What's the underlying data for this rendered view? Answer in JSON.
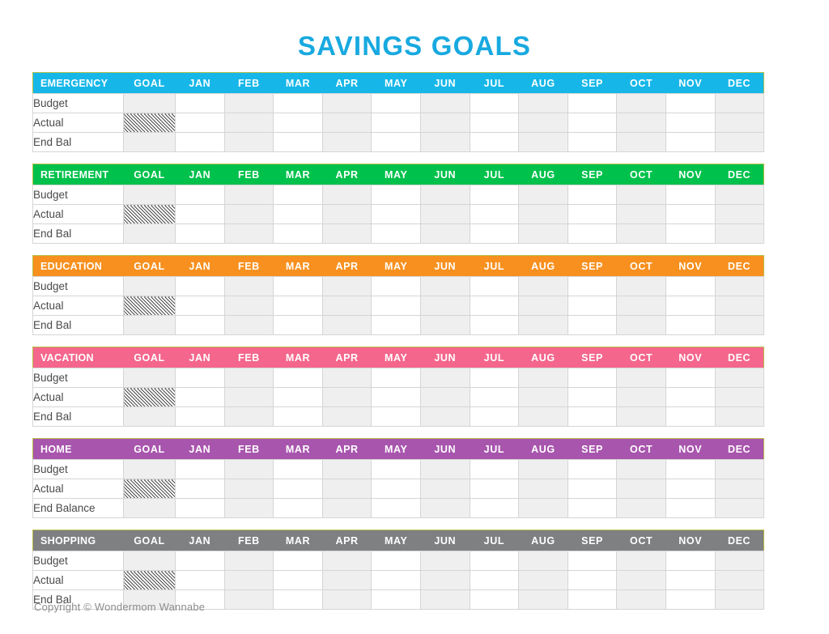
{
  "page": {
    "title": "SAVINGS GOALS",
    "title_color": "#18A9E0",
    "footer": "Copyright © Wondermom Wannabe"
  },
  "columns": {
    "goal": "GOAL",
    "months": [
      "JAN",
      "FEB",
      "MAR",
      "APR",
      "MAY",
      "JUN",
      "JUL",
      "AUG",
      "SEP",
      "OCT",
      "NOV",
      "DEC"
    ]
  },
  "sections": [
    {
      "name": "EMERGENCY",
      "color": "#16B7E8",
      "rows": [
        {
          "label": "Budget",
          "goal": "",
          "values": [
            "",
            "",
            "",
            "",
            "",
            "",
            "",
            "",
            "",
            "",
            "",
            ""
          ]
        },
        {
          "label": "Actual",
          "goal": "",
          "goal_hatch": true,
          "values": [
            "",
            "",
            "",
            "",
            "",
            "",
            "",
            "",
            "",
            "",
            "",
            ""
          ]
        },
        {
          "label": "End Bal",
          "goal": "",
          "values": [
            "",
            "",
            "",
            "",
            "",
            "",
            "",
            "",
            "",
            "",
            "",
            ""
          ]
        }
      ]
    },
    {
      "name": "RETIREMENT",
      "color": "#00C14B",
      "rows": [
        {
          "label": "Budget",
          "goal": "",
          "values": [
            "",
            "",
            "",
            "",
            "",
            "",
            "",
            "",
            "",
            "",
            "",
            ""
          ]
        },
        {
          "label": "Actual",
          "goal": "",
          "goal_hatch": true,
          "values": [
            "",
            "",
            "",
            "",
            "",
            "",
            "",
            "",
            "",
            "",
            "",
            ""
          ]
        },
        {
          "label": "End Bal",
          "goal": "",
          "values": [
            "",
            "",
            "",
            "",
            "",
            "",
            "",
            "",
            "",
            "",
            "",
            ""
          ]
        }
      ]
    },
    {
      "name": "EDUCATION",
      "color": "#F7901E",
      "rows": [
        {
          "label": "Budget",
          "goal": "",
          "values": [
            "",
            "",
            "",
            "",
            "",
            "",
            "",
            "",
            "",
            "",
            "",
            ""
          ]
        },
        {
          "label": "Actual",
          "goal": "",
          "goal_hatch": true,
          "values": [
            "",
            "",
            "",
            "",
            "",
            "",
            "",
            "",
            "",
            "",
            "",
            ""
          ]
        },
        {
          "label": "End Bal",
          "goal": "",
          "values": [
            "",
            "",
            "",
            "",
            "",
            "",
            "",
            "",
            "",
            "",
            "",
            ""
          ]
        }
      ]
    },
    {
      "name": "VACATION",
      "color": "#F4668C",
      "rows": [
        {
          "label": "Budget",
          "goal": "",
          "values": [
            "",
            "",
            "",
            "",
            "",
            "",
            "",
            "",
            "",
            "",
            "",
            ""
          ]
        },
        {
          "label": "Actual",
          "goal": "",
          "goal_hatch": true,
          "values": [
            "",
            "",
            "",
            "",
            "",
            "",
            "",
            "",
            "",
            "",
            "",
            ""
          ]
        },
        {
          "label": "End Bal",
          "goal": "",
          "values": [
            "",
            "",
            "",
            "",
            "",
            "",
            "",
            "",
            "",
            "",
            "",
            ""
          ]
        }
      ]
    },
    {
      "name": "HOME",
      "color": "#A855AD",
      "rows": [
        {
          "label": "Budget",
          "goal": "",
          "values": [
            "",
            "",
            "",
            "",
            "",
            "",
            "",
            "",
            "",
            "",
            "",
            ""
          ]
        },
        {
          "label": "Actual",
          "goal": "",
          "goal_hatch": true,
          "values": [
            "",
            "",
            "",
            "",
            "",
            "",
            "",
            "",
            "",
            "",
            "",
            ""
          ]
        },
        {
          "label": "End Balance",
          "goal": "",
          "values": [
            "",
            "",
            "",
            "",
            "",
            "",
            "",
            "",
            "",
            "",
            "",
            ""
          ]
        }
      ]
    },
    {
      "name": "SHOPPING",
      "color": "#7E8082",
      "rows": [
        {
          "label": "Budget",
          "goal": "",
          "values": [
            "",
            "",
            "",
            "",
            "",
            "",
            "",
            "",
            "",
            "",
            "",
            ""
          ]
        },
        {
          "label": "Actual",
          "goal": "",
          "goal_hatch": true,
          "values": [
            "",
            "",
            "",
            "",
            "",
            "",
            "",
            "",
            "",
            "",
            "",
            ""
          ]
        },
        {
          "label": "End Bal",
          "goal": "",
          "values": [
            "",
            "",
            "",
            "",
            "",
            "",
            "",
            "",
            "",
            "",
            "",
            ""
          ]
        }
      ]
    }
  ]
}
